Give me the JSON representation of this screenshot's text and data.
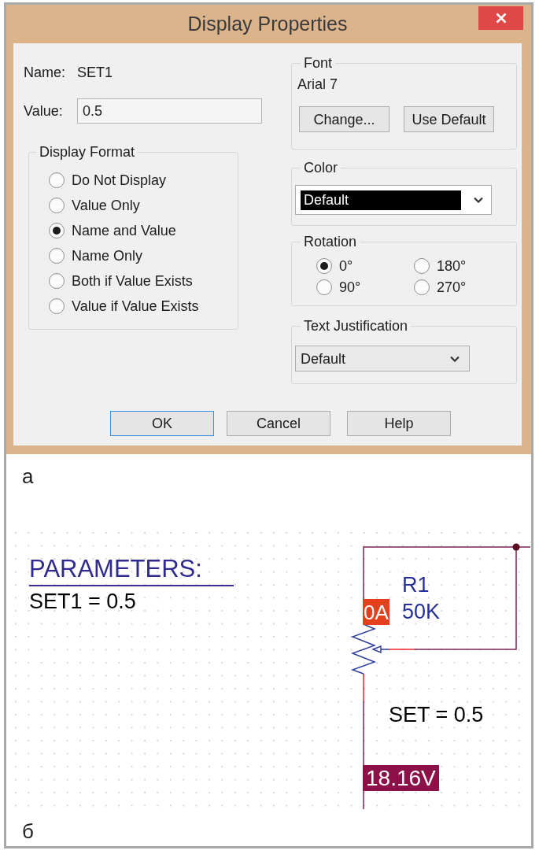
{
  "dialog": {
    "title": "Display Properties",
    "name": {
      "label": "Name:",
      "value": "SET1"
    },
    "value_field": {
      "label": "Value:",
      "value": "0.5"
    },
    "display_format": {
      "title": "Display Format",
      "options": [
        {
          "label": "Do Not Display",
          "selected": false
        },
        {
          "label": "Value Only",
          "selected": false
        },
        {
          "label": "Name and Value",
          "selected": true
        },
        {
          "label": "Name Only",
          "selected": false
        },
        {
          "label": "Both if Value Exists",
          "selected": false
        },
        {
          "label": "Value if Value Exists",
          "selected": false
        }
      ]
    },
    "font": {
      "title": "Font",
      "current": "Arial 7",
      "buttons": [
        "Change...",
        "Use Default"
      ]
    },
    "color": {
      "title": "Color",
      "value": "Default"
    },
    "rotation": {
      "title": "Rotation",
      "options": [
        {
          "label": "0°",
          "selected": true
        },
        {
          "label": "180°",
          "selected": false
        },
        {
          "label": "90°",
          "selected": false
        },
        {
          "label": "270°",
          "selected": false
        }
      ]
    },
    "text_justification": {
      "title": "Text Justification",
      "value": "Default"
    },
    "buttons": [
      {
        "label": "OK",
        "focused": true
      },
      {
        "label": "Cancel",
        "focused": false
      },
      {
        "label": "Help",
        "focused": false
      }
    ]
  },
  "caption_a": "а",
  "schematic": {
    "parameters": {
      "title": "PARAMETERS:",
      "lines": [
        "SET1 = 0.5"
      ]
    },
    "resistor": {
      "name": "R1",
      "value": "50K",
      "property": "SET = 0.5"
    },
    "current_probe": "0A",
    "voltage_probe": "18.16V"
  },
  "caption_b": "б"
}
